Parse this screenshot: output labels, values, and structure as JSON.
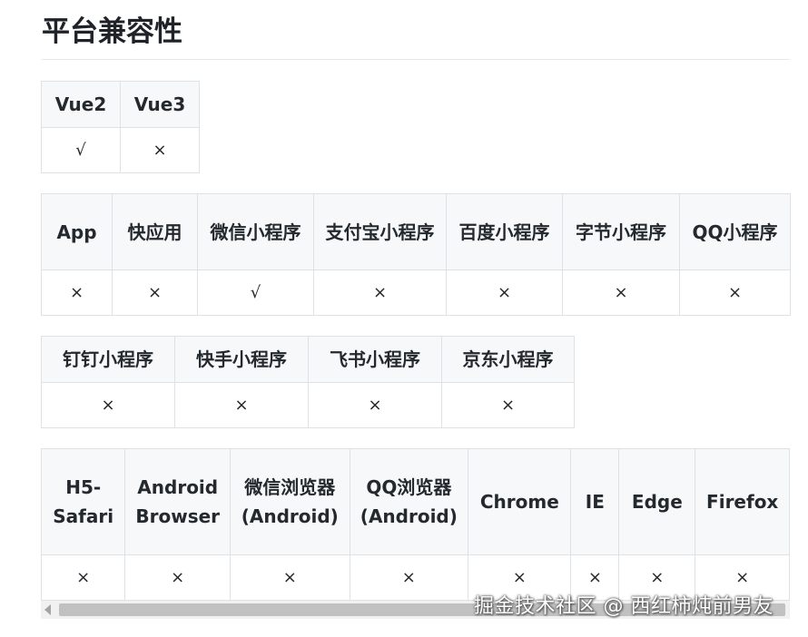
{
  "title": "平台兼容性",
  "vue_table": {
    "headers": [
      "Vue2",
      "Vue3"
    ],
    "values": [
      "√",
      "×"
    ]
  },
  "miniapp_table": {
    "headers": [
      "App",
      "快应用",
      "微信小程序",
      "支付宝小程序",
      "百度小程序",
      "字节小程序",
      "QQ小程序"
    ],
    "values": [
      "×",
      "×",
      "√",
      "×",
      "×",
      "×",
      "×"
    ]
  },
  "other_miniapp_table": {
    "headers": [
      "钉钉小程序",
      "快手小程序",
      "飞书小程序",
      "京东小程序"
    ],
    "values": [
      "×",
      "×",
      "×",
      "×"
    ]
  },
  "browser_table": {
    "headers": [
      "H5-Safari",
      "Android Browser",
      "微信浏览器(Android)",
      "QQ浏览器(Android)",
      "Chrome",
      "IE",
      "Edge",
      "Firefox"
    ],
    "values": [
      "×",
      "×",
      "×",
      "×",
      "×",
      "×",
      "×",
      "×"
    ]
  },
  "watermark": "掘金技术社区 @ 西红柿炖前男友"
}
